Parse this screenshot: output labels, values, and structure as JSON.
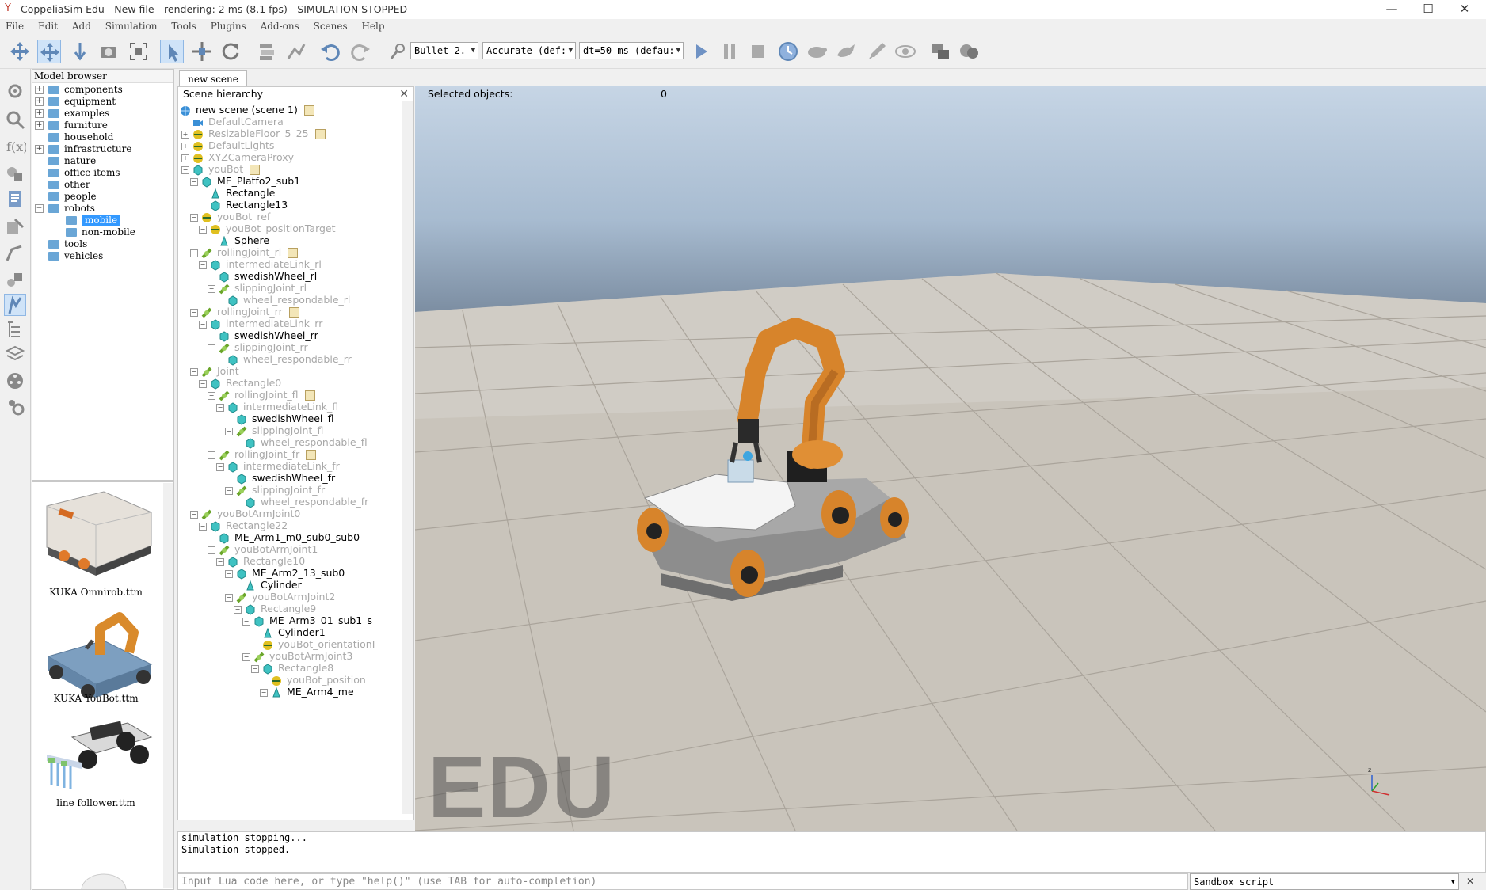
{
  "window": {
    "title": "CoppeliaSim Edu - New file - rendering: 2 ms (8.1 fps) - SIMULATION STOPPED",
    "minimize": "—",
    "maximize": "☐",
    "close": "✕"
  },
  "menu": [
    "File",
    "Edit",
    "Add",
    "Simulation",
    "Tools",
    "Plugins",
    "Add-ons",
    "Scenes",
    "Help"
  ],
  "toolbar": {
    "engine": "Bullet 2.",
    "accuracy": "Accurate (def:",
    "timestep": "dt=50 ms (defau:",
    "icons": [
      "move-camera-icon",
      "rotate-camera-icon",
      "shift-camera-icon",
      "zoom-camera-icon",
      "fit-view-icon",
      "click-select-icon",
      "object-shift-icon",
      "object-rotate-icon",
      "assemble-icon",
      "transfer-dna-icon",
      "undo-icon",
      "redo-icon",
      "pick-icon",
      "play-icon",
      "pause-icon",
      "stop-icon",
      "realtime-icon",
      "slow-down-icon",
      "speed-up-icon",
      "thread-rendering-icon",
      "visualization-icon",
      "page-selector-icon",
      "scene-selector-icon"
    ]
  },
  "model_browser": {
    "title": "Model browser",
    "items": [
      {
        "label": "components",
        "exp": "+"
      },
      {
        "label": "equipment",
        "exp": "+"
      },
      {
        "label": "examples",
        "exp": "+"
      },
      {
        "label": "furniture",
        "exp": "+"
      },
      {
        "label": "household",
        "exp": ""
      },
      {
        "label": "infrastructure",
        "exp": "+"
      },
      {
        "label": "nature",
        "exp": ""
      },
      {
        "label": "office items",
        "exp": ""
      },
      {
        "label": "other",
        "exp": ""
      },
      {
        "label": "people",
        "exp": ""
      },
      {
        "label": "robots",
        "exp": "−"
      },
      {
        "label": "mobile",
        "exp": "",
        "selected": true,
        "indent": 1
      },
      {
        "label": "non-mobile",
        "exp": "",
        "indent": 1
      },
      {
        "label": "tools",
        "exp": ""
      },
      {
        "label": "vehicles",
        "exp": ""
      }
    ],
    "thumbnails": [
      "KUKA Omnirob.ttm",
      "KUKA YouBot.ttm",
      "line follower.ttm"
    ]
  },
  "scene_tab": "new scene",
  "hierarchy": {
    "title": "Scene hierarchy",
    "nodes": [
      {
        "t": "new scene (scene 1)",
        "d": 0,
        "ic": "scene",
        "dim": false,
        "box": "",
        "script": true
      },
      {
        "t": "DefaultCamera",
        "d": 1,
        "ic": "camera",
        "dim": true,
        "box": ""
      },
      {
        "t": "ResizableFloor_5_25",
        "d": 1,
        "ic": "dummy",
        "dim": true,
        "box": "+",
        "script": true
      },
      {
        "t": "DefaultLights",
        "d": 1,
        "ic": "dummy",
        "dim": true,
        "box": "+"
      },
      {
        "t": "XYZCameraProxy",
        "d": 1,
        "ic": "dummy",
        "dim": true,
        "box": "+"
      },
      {
        "t": "youBot",
        "d": 1,
        "ic": "shape",
        "dim": true,
        "box": "−",
        "script": true
      },
      {
        "t": "ME_Platfo2_sub1",
        "d": 2,
        "ic": "shape",
        "dim": false,
        "box": "−"
      },
      {
        "t": "Rectangle",
        "d": 3,
        "ic": "mesh",
        "dim": false,
        "box": ""
      },
      {
        "t": "Rectangle13",
        "d": 3,
        "ic": "shape",
        "dim": false,
        "box": ""
      },
      {
        "t": "youBot_ref",
        "d": 2,
        "ic": "dummy",
        "dim": true,
        "box": "−"
      },
      {
        "t": "youBot_positionTarget",
        "d": 3,
        "ic": "dummy",
        "dim": true,
        "box": "−"
      },
      {
        "t": "Sphere",
        "d": 4,
        "ic": "mesh",
        "dim": false,
        "box": ""
      },
      {
        "t": "rollingJoint_rl",
        "d": 2,
        "ic": "joint",
        "dim": true,
        "box": "−",
        "script": true
      },
      {
        "t": "intermediateLink_rl",
        "d": 3,
        "ic": "shape",
        "dim": true,
        "box": "−"
      },
      {
        "t": "swedishWheel_rl",
        "d": 4,
        "ic": "shape",
        "dim": false,
        "box": ""
      },
      {
        "t": "slippingJoint_rl",
        "d": 4,
        "ic": "joint",
        "dim": true,
        "box": "−"
      },
      {
        "t": "wheel_respondable_rl",
        "d": 5,
        "ic": "shape",
        "dim": true,
        "box": ""
      },
      {
        "t": "rollingJoint_rr",
        "d": 2,
        "ic": "joint",
        "dim": true,
        "box": "−",
        "script": true
      },
      {
        "t": "intermediateLink_rr",
        "d": 3,
        "ic": "shape",
        "dim": true,
        "box": "−"
      },
      {
        "t": "swedishWheel_rr",
        "d": 4,
        "ic": "shape",
        "dim": false,
        "box": ""
      },
      {
        "t": "slippingJoint_rr",
        "d": 4,
        "ic": "joint",
        "dim": true,
        "box": "−"
      },
      {
        "t": "wheel_respondable_rr",
        "d": 5,
        "ic": "shape",
        "dim": true,
        "box": ""
      },
      {
        "t": "Joint",
        "d": 2,
        "ic": "joint",
        "dim": true,
        "box": "−"
      },
      {
        "t": "Rectangle0",
        "d": 3,
        "ic": "shape",
        "dim": true,
        "box": "−"
      },
      {
        "t": "rollingJoint_fl",
        "d": 4,
        "ic": "joint",
        "dim": true,
        "box": "−",
        "script": true
      },
      {
        "t": "intermediateLink_fl",
        "d": 5,
        "ic": "shape",
        "dim": true,
        "box": "−"
      },
      {
        "t": "swedishWheel_fl",
        "d": 6,
        "ic": "shape",
        "dim": false,
        "box": ""
      },
      {
        "t": "slippingJoint_fl",
        "d": 6,
        "ic": "joint",
        "dim": true,
        "box": "−"
      },
      {
        "t": "wheel_respondable_fl",
        "d": 7,
        "ic": "shape",
        "dim": true,
        "box": ""
      },
      {
        "t": "rollingJoint_fr",
        "d": 4,
        "ic": "joint",
        "dim": true,
        "box": "−",
        "script": true
      },
      {
        "t": "intermediateLink_fr",
        "d": 5,
        "ic": "shape",
        "dim": true,
        "box": "−"
      },
      {
        "t": "swedishWheel_fr",
        "d": 6,
        "ic": "shape",
        "dim": false,
        "box": ""
      },
      {
        "t": "slippingJoint_fr",
        "d": 6,
        "ic": "joint",
        "dim": true,
        "box": "−"
      },
      {
        "t": "wheel_respondable_fr",
        "d": 7,
        "ic": "shape",
        "dim": true,
        "box": ""
      },
      {
        "t": "youBotArmJoint0",
        "d": 2,
        "ic": "joint",
        "dim": true,
        "box": "−"
      },
      {
        "t": "Rectangle22",
        "d": 3,
        "ic": "shape",
        "dim": true,
        "box": "−"
      },
      {
        "t": "ME_Arm1_m0_sub0_sub0",
        "d": 4,
        "ic": "shape",
        "dim": false,
        "box": ""
      },
      {
        "t": "youBotArmJoint1",
        "d": 4,
        "ic": "joint",
        "dim": true,
        "box": "−"
      },
      {
        "t": "Rectangle10",
        "d": 5,
        "ic": "shape",
        "dim": true,
        "box": "−"
      },
      {
        "t": "ME_Arm2_13_sub0",
        "d": 6,
        "ic": "shape",
        "dim": false,
        "box": "−"
      },
      {
        "t": "Cylinder",
        "d": 7,
        "ic": "mesh",
        "dim": false,
        "box": ""
      },
      {
        "t": "youBotArmJoint2",
        "d": 6,
        "ic": "joint",
        "dim": true,
        "box": "−"
      },
      {
        "t": "Rectangle9",
        "d": 7,
        "ic": "shape",
        "dim": true,
        "box": "−"
      },
      {
        "t": "ME_Arm3_01_sub1_s",
        "d": 8,
        "ic": "shape",
        "dim": false,
        "box": "−"
      },
      {
        "t": "Cylinder1",
        "d": 9,
        "ic": "mesh",
        "dim": false,
        "box": ""
      },
      {
        "t": "youBot_orientationI",
        "d": 9,
        "ic": "dummy",
        "dim": true,
        "box": ""
      },
      {
        "t": "youBotArmJoint3",
        "d": 8,
        "ic": "joint",
        "dim": true,
        "box": "−"
      },
      {
        "t": "Rectangle8",
        "d": 9,
        "ic": "shape",
        "dim": true,
        "box": "−"
      },
      {
        "t": "youBot_position",
        "d": 10,
        "ic": "dummy",
        "dim": true,
        "box": ""
      },
      {
        "t": "ME_Arm4_me",
        "d": 10,
        "ic": "mesh",
        "dim": false,
        "box": "−"
      }
    ]
  },
  "viewport": {
    "selected_label": "Selected objects:",
    "selected_count": "0",
    "watermark": "EDU"
  },
  "console": {
    "lines": [
      "simulation stopping...",
      "Simulation stopped."
    ],
    "input_placeholder": "Input Lua code here, or type \"help()\" (use TAB for auto-completion)",
    "script_selector": "Sandbox script",
    "close": "✕"
  }
}
